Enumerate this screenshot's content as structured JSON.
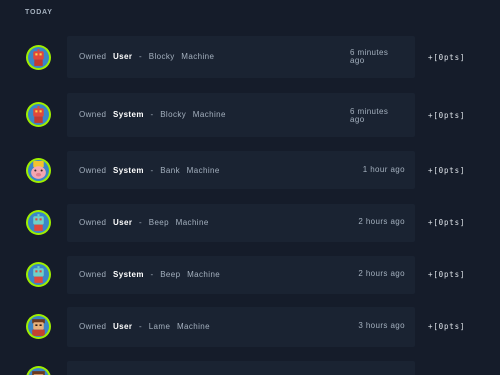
{
  "section": {
    "label": "TODAY"
  },
  "activities": [
    {
      "verb": "Owned",
      "own_type": "User",
      "sep": "-",
      "target_name": "Blocky",
      "target_type": "Machine",
      "time": "6 minutes ago",
      "points": "+[0pts]",
      "avatar": "red-robot-avatar"
    },
    {
      "verb": "Owned",
      "own_type": "System",
      "sep": "-",
      "target_name": "Blocky",
      "target_type": "Machine",
      "time": "6 minutes ago",
      "points": "+[0pts]",
      "avatar": "red-robot-avatar"
    },
    {
      "verb": "Owned",
      "own_type": "System",
      "sep": "-",
      "target_name": "Bank",
      "target_type": "Machine",
      "time": "1 hour ago",
      "points": "+[0pts]",
      "avatar": "piggy-bank-avatar"
    },
    {
      "verb": "Owned",
      "own_type": "User",
      "sep": "-",
      "target_name": "Beep",
      "target_type": "Machine",
      "time": "2 hours ago",
      "points": "+[0pts]",
      "avatar": "teal-robot-avatar"
    },
    {
      "verb": "Owned",
      "own_type": "System",
      "sep": "-",
      "target_name": "Beep",
      "target_type": "Machine",
      "time": "2 hours ago",
      "points": "+[0pts]",
      "avatar": "teal-robot-avatar"
    },
    {
      "verb": "Owned",
      "own_type": "User",
      "sep": "-",
      "target_name": "Lame",
      "target_type": "Machine",
      "time": "3 hours ago",
      "points": "+[0pts]",
      "avatar": "brown-character-avatar"
    }
  ],
  "colors": {
    "background": "#151c2a",
    "card": "#1a2332",
    "accent": "#9fef00",
    "muted_text": "#a4b0be",
    "strong_text": "#ffffff"
  }
}
